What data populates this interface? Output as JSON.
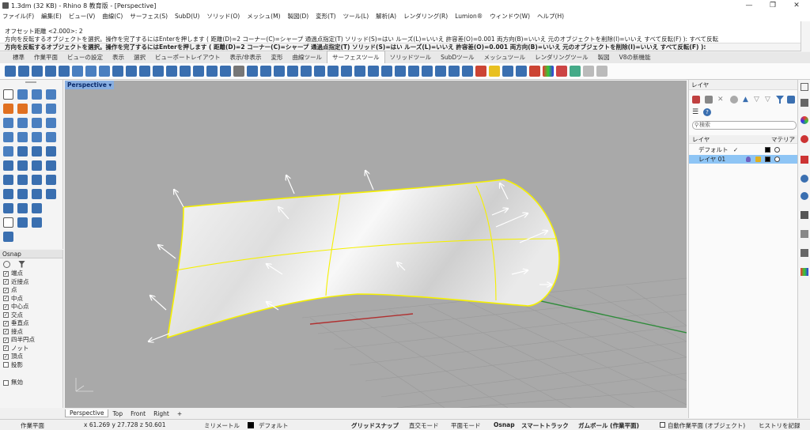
{
  "window": {
    "title": "1.3dm (32 KB) - Rhino 8 教育版 - [Perspective]",
    "controls": [
      "—",
      "❐",
      "✕"
    ]
  },
  "menu": [
    "ファイル(F)",
    "編集(E)",
    "ビュー(V)",
    "曲線(C)",
    "サーフェス(S)",
    "SubD(U)",
    "ソリッド(O)",
    "メッシュ(M)",
    "製図(D)",
    "変形(T)",
    "ツール(L)",
    "解析(A)",
    "レンダリング(R)",
    "Lumion®",
    "ウィンドウ(W)",
    "ヘルプ(H)"
  ],
  "command": {
    "history_1": "オフセット距離 <2.000>: 2",
    "history_2": "方向を反転するオブジェクトを選択。操作を完了するにはEnterを押します ( 距離(D)=2  コーナー(C)=シャープ  通過点指定(T)  ソリッド(S)=はい  ルーズ(L)=いいえ  許容差(O)=0.001  両方向(B)=いいえ  元のオブジェクトを削除(I)=いいえ  すべて反転(F) ): すべて反転",
    "prompt": "方向を反転するオブジェクトを選択。操作を完了するにはEnterを押します ( 距離(D)=2  コーナー(C)=シャープ  通過点指定(T)  ソリッド(S)=はい  ルーズ(L)=いいえ  許容差(O)=0.001  両方向(B)=いいえ  元のオブジェクトを削除(I)=いいえ  すべて反転(F) ):"
  },
  "toolbar_tabs": [
    "標準",
    "作業平面",
    "ビューの設定",
    "表示",
    "選択",
    "ビューポートレイアウト",
    "表示/非表示",
    "変形",
    "曲線ツール",
    "サーフェスツール",
    "ソリッドツール",
    "SubDツール",
    "メッシュツール",
    "レンダリングツール",
    "製図",
    "V8の新機能"
  ],
  "active_toolbar_tab": "サーフェスツール",
  "viewport": {
    "label": "Perspective",
    "tabs": [
      "Perspective",
      "Top",
      "Front",
      "Right"
    ],
    "active_tab": "Perspective",
    "add_tab_icon": "+"
  },
  "osnap": {
    "title": "Osnap",
    "items": [
      {
        "label": "端点",
        "checked": true
      },
      {
        "label": "近接点",
        "checked": true
      },
      {
        "label": "点",
        "checked": true
      },
      {
        "label": "中点",
        "checked": true
      },
      {
        "label": "中心点",
        "checked": true
      },
      {
        "label": "交点",
        "checked": true
      },
      {
        "label": "垂直点",
        "checked": true
      },
      {
        "label": "接点",
        "checked": true
      },
      {
        "label": "四半円点",
        "checked": true
      },
      {
        "label": "ノット",
        "checked": true
      },
      {
        "label": "頂点",
        "checked": true
      },
      {
        "label": "投影",
        "checked": false
      },
      {
        "label": "無効",
        "checked": false
      }
    ]
  },
  "layers": {
    "title": "レイヤ",
    "search_placeholder": "検索",
    "col_name": "レイヤ",
    "col_material": "マテリア",
    "rows": [
      {
        "name": "デフォルト",
        "current": "✓",
        "selected": false
      },
      {
        "name": "レイヤ 01",
        "current": "",
        "selected": true
      }
    ]
  },
  "status": {
    "cplane": "作業平面",
    "coords": "x 61.269  y 27.728  z 50.601",
    "units": "ミリメートル",
    "layer": "デフォルト",
    "grid_snap": "グリッドスナップ",
    "ortho": "直交モード",
    "planar": "平面モード",
    "osnap": "Osnap",
    "smarttrack": "スマートトラック",
    "gumball": "ガムボール (作業平面)",
    "auto_cplane": "自動作業平面 (オブジェクト)",
    "history": "ヒストリを記録"
  },
  "colors": {
    "surface_edge": "#f5f000",
    "selected_layer": "#8ec5f5",
    "viewport_label": "#88aee0",
    "viewport_bg": "#a9a9a9"
  }
}
